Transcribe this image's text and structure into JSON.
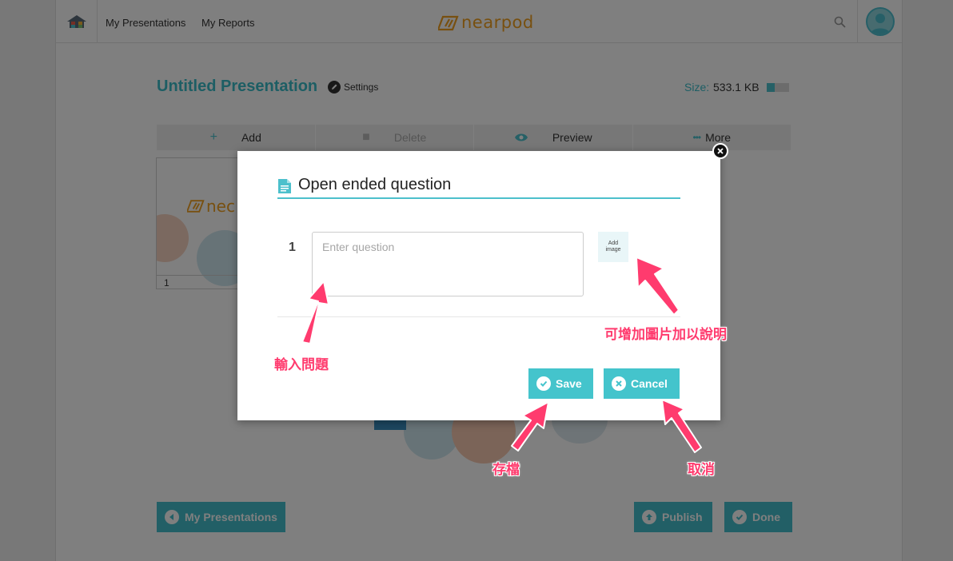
{
  "colors": {
    "accent": "#44c4cc",
    "title": "#3abcc9",
    "logo": "#f0a020",
    "annotation": "#ff3b6e"
  },
  "nav": {
    "home_icon": "home-icon",
    "links": [
      "My Presentations",
      "My Reports"
    ],
    "logo_text": "nearpod",
    "search_icon": "search-icon",
    "avatar_icon": "user-avatar-icon"
  },
  "presentation": {
    "title": "Untitled Presentation",
    "settings_label": "Settings",
    "size_label": "Size:",
    "size_value": "533.1 KB",
    "size_fraction": 0.35
  },
  "toolbar": {
    "add": "Add",
    "delete": "Delete",
    "preview": "Preview",
    "more": "More"
  },
  "thumbnail": {
    "logo_text": "nec",
    "slide_number": "1"
  },
  "bottom": {
    "my_presentations": "My Presentations",
    "publish": "Publish",
    "done": "Done"
  },
  "modal": {
    "title": "Open ended question",
    "question_number": "1",
    "question_placeholder": "Enter question",
    "question_value": "",
    "add_image_line1": "Add",
    "add_image_line2": "image",
    "save": "Save",
    "cancel": "Cancel"
  },
  "annotations": {
    "enter_question": "輸入問題",
    "add_image_hint": "可增加圖片加以說明",
    "save_hint": "存檔",
    "cancel_hint": "取消"
  }
}
